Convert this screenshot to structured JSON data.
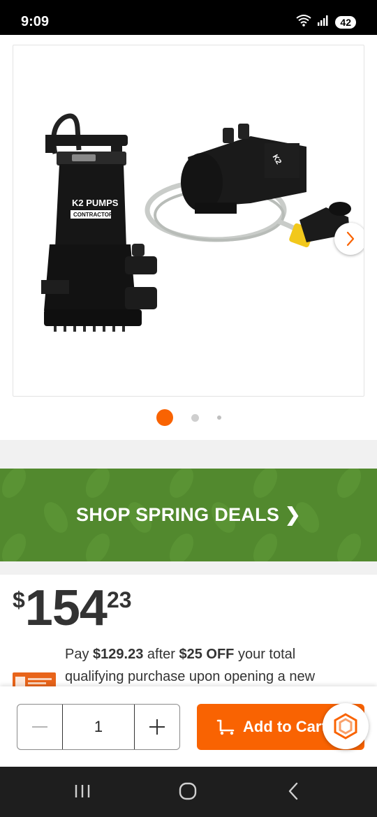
{
  "status_bar": {
    "time": "9:09",
    "battery": "42",
    "icons": [
      "wifi-icon",
      "signal-icon"
    ]
  },
  "gallery": {
    "image_alt": "K2 Pumps contractor series utility pump and shallow well pump kit",
    "logo_text": "K2 PUMPS",
    "logo_sub": "CONTRACTOR",
    "active_index": 0,
    "dot_count": 3
  },
  "promo": {
    "label": "SHOP SPRING DEALS ❯",
    "color": "#52892e"
  },
  "price": {
    "symbol": "$",
    "dollars": "154",
    "cents": "23"
  },
  "offer": {
    "prefix": "Pay ",
    "amount": "$129.23",
    "middle": " after ",
    "discount": "$25 OFF",
    "suffix": " your total qualifying purchase upon opening a new"
  },
  "action_bar": {
    "quantity": "1",
    "add_to_cart_label": "Add to Cart",
    "accent": "#f96302"
  }
}
